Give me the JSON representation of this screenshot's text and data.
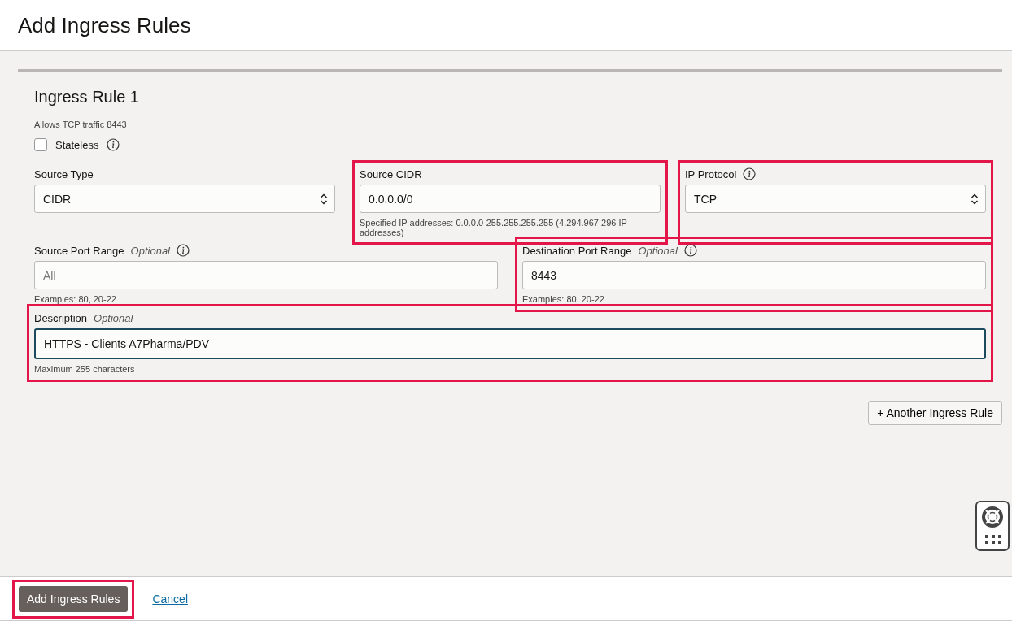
{
  "header": {
    "title": "Add Ingress Rules"
  },
  "rule": {
    "title": "Ingress Rule 1",
    "summary": "Allows TCP traffic 8443",
    "stateless": {
      "label": "Stateless",
      "checked": false
    },
    "rows": [
      {
        "fields": [
          {
            "kind": "select",
            "label": "Source Type",
            "value": "CIDR",
            "info": false,
            "highlighted": false
          },
          {
            "kind": "input",
            "label": "Source CIDR",
            "value": "0.0.0.0/0",
            "hint": "Specified IP addresses: 0.0.0.0-255.255.255.255 (4.294.967.296 IP addresses)",
            "info": false,
            "highlighted": true
          },
          {
            "kind": "select",
            "label": "IP Protocol",
            "value": "TCP",
            "info": true,
            "highlighted": true
          }
        ]
      },
      {
        "fields": [
          {
            "kind": "input",
            "label": "Source Port Range",
            "optional": "Optional",
            "placeholder": "All",
            "hint": "Examples: 80, 20-22",
            "info": true,
            "highlighted": false
          },
          {
            "kind": "input",
            "label": "Destination Port Range",
            "optional": "Optional",
            "value": "8443",
            "hint": "Examples: 80, 20-22",
            "info": true,
            "highlighted": true
          }
        ]
      },
      {
        "fields": [
          {
            "kind": "input",
            "label": "Description",
            "optional": "Optional",
            "value": "HTTPS - Clients A7Pharma/PDV",
            "hint": "Maximum 255 characters",
            "info": false,
            "highlighted": true,
            "focused": true
          }
        ]
      }
    ]
  },
  "add_rule_button": "+ Another Ingress Rule",
  "footer": {
    "primary": {
      "label": "Add Ingress Rules",
      "highlighted": true
    },
    "cancel": "Cancel"
  }
}
